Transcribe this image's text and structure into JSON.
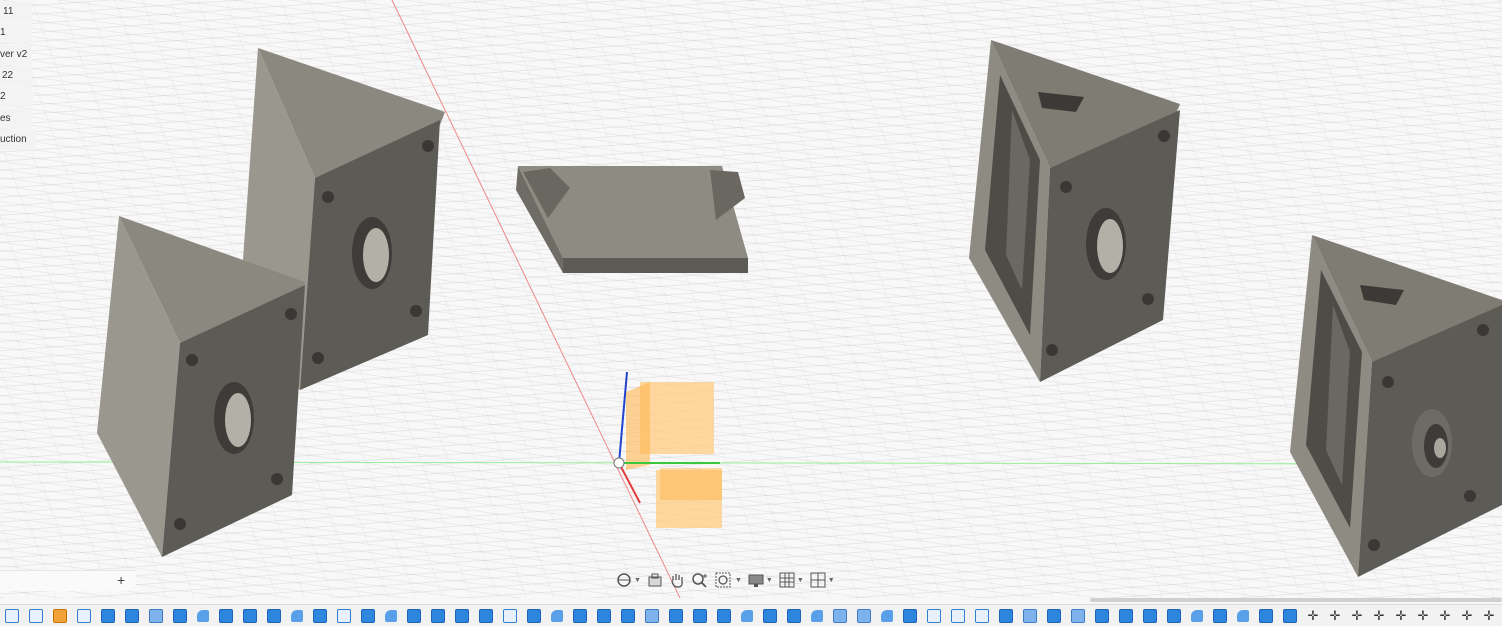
{
  "browser": {
    "items": [
      {
        "label": "11"
      },
      {
        "label": "1"
      },
      {
        "label": "ver v2"
      },
      {
        "label": "22"
      },
      {
        "label": "2"
      },
      {
        "label": "es"
      },
      {
        "label": "uction"
      }
    ],
    "add_tab_label": "+"
  },
  "colors": {
    "body_dark": "#5d5b55",
    "body_mid": "#7d7a72",
    "body_light": "#98958c",
    "axis_red": "#e23b3b",
    "axis_green": "#3cc83c",
    "axis_blue": "#2244cc",
    "plane_orange": "#ffcc80",
    "viewport_bg": "#f8f8f8"
  },
  "navbar": {
    "icons": [
      "orbit-icon",
      "look-at-icon",
      "pan-icon",
      "zoom-icon",
      "fit-icon",
      "display-settings-icon",
      "grid-icon",
      "viewports-icon"
    ]
  },
  "timeline": {
    "items": [
      "sketch",
      "sketch",
      "extrude",
      "sketch",
      "extrude",
      "extrude",
      "shell",
      "extrude",
      "fillet",
      "extrude",
      "extrude",
      "extrude",
      "fillet",
      "extrude",
      "sketch",
      "extrude",
      "fillet",
      "extrude",
      "extrude",
      "extrude",
      "extrude",
      "sketch",
      "extrude",
      "fillet",
      "extrude",
      "extrude",
      "extrude",
      "shell",
      "extrude",
      "extrude",
      "extrude",
      "fillet",
      "extrude",
      "extrude",
      "fillet",
      "shell",
      "shell",
      "fillet",
      "extrude",
      "sketch",
      "sketch",
      "sketch",
      "extrude",
      "shell",
      "extrude",
      "shell",
      "extrude",
      "extrude",
      "extrude",
      "extrude",
      "fillet",
      "extrude",
      "fillet",
      "extrude",
      "extrude",
      "move",
      "move",
      "move",
      "move",
      "move",
      "move",
      "move",
      "move",
      "move",
      "move"
    ]
  }
}
